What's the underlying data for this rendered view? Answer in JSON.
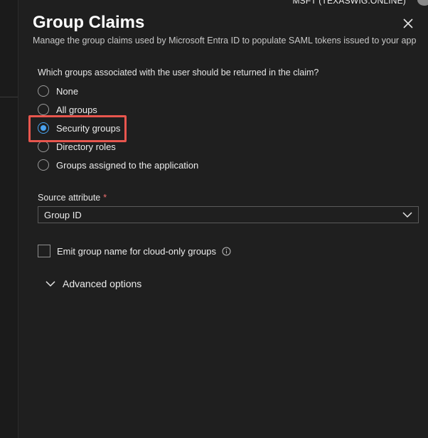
{
  "topbar": {
    "account": "MSFT (TEXASWIG.ONLINE)"
  },
  "panel": {
    "title": "Group Claims",
    "subtitle": "Manage the group claims used by Microsoft Entra ID to populate SAML tokens issued to your app",
    "question": "Which groups associated with the user should be returned in the claim?",
    "options": [
      {
        "label": "None",
        "selected": false
      },
      {
        "label": "All groups",
        "selected": false
      },
      {
        "label": "Security groups",
        "selected": true
      },
      {
        "label": "Directory roles",
        "selected": false
      },
      {
        "label": "Groups assigned to the application",
        "selected": false
      }
    ],
    "source_attribute": {
      "label": "Source attribute",
      "required_marker": "*",
      "value": "Group ID"
    },
    "emit_checkbox": {
      "label": "Emit group name for cloud-only groups",
      "checked": false
    },
    "advanced": {
      "label": "Advanced options"
    }
  },
  "colors": {
    "accent": "#4aa3f0",
    "highlight": "#e8564e",
    "required": "#f07070",
    "background": "#1f1f1f"
  }
}
